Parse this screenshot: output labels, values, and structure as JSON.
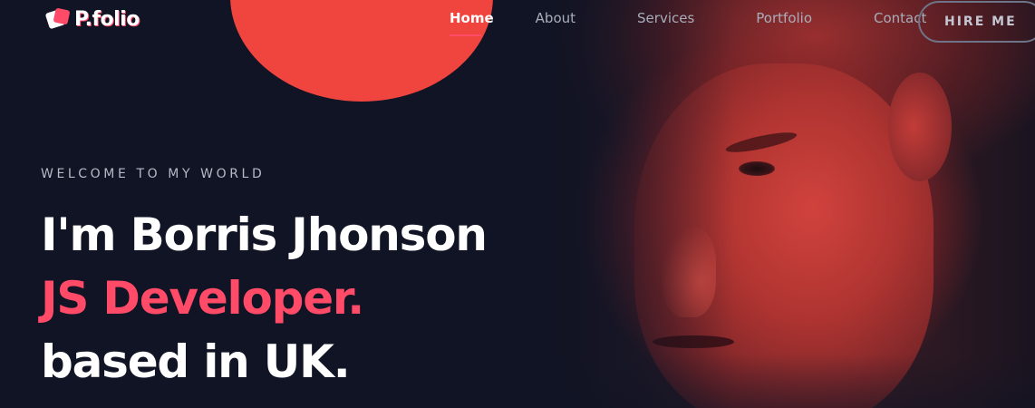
{
  "brand": {
    "name": "P.folio",
    "accent_color": "#ff4a68",
    "background_color": "#101424",
    "logo_icon": "cube-logo-icon"
  },
  "nav": {
    "items": [
      {
        "label": "Home",
        "active": true
      },
      {
        "label": "About",
        "active": false
      },
      {
        "label": "Services",
        "active": false
      },
      {
        "label": "Portfolio",
        "active": false
      },
      {
        "label": "Contact",
        "active": false
      }
    ],
    "cta_label": "HIRE ME"
  },
  "hero": {
    "eyebrow": "WELCOME TO MY WORLD",
    "line1": "I'm Borris Jhonson",
    "line2": "JS Developer.",
    "line3": "based in UK.",
    "photo": "portrait-photo",
    "circle_color": "#f0443f"
  }
}
